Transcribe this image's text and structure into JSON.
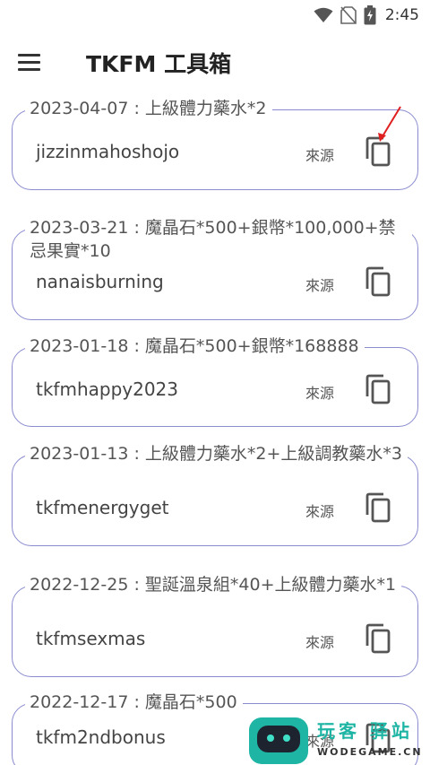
{
  "status_bar": {
    "time": "2:45",
    "icons": [
      "wifi-icon",
      "no-sim-icon",
      "battery-charging-icon"
    ]
  },
  "app_bar": {
    "menu_icon": "hamburger-menu-icon",
    "title": "TKFM 工具箱"
  },
  "codes": [
    {
      "title": "2023-04-07 : 上級體力藥水*2",
      "code": "jizzinmahoshojo",
      "source_label": "來源",
      "copy_icon": "copy-icon"
    },
    {
      "title": "2023-03-21 : 魔晶石*500+銀幣*100,000+禁忌果實*10",
      "code": "nanaisburning",
      "source_label": "來源",
      "copy_icon": "copy-icon"
    },
    {
      "title": "2023-01-18 : 魔晶石*500+銀幣*168888",
      "code": "tkfmhappy2023",
      "source_label": "來源",
      "copy_icon": "copy-icon"
    },
    {
      "title": "2023-01-13 : 上級體力藥水*2+上級調教藥水*3",
      "code": "tkfmenergyget",
      "source_label": "來源",
      "copy_icon": "copy-icon"
    },
    {
      "title": "2022-12-25 : 聖誕溫泉組*40+上級體力藥水*1",
      "code": "tkfmsexmas",
      "source_label": "來源",
      "copy_icon": "copy-icon"
    },
    {
      "title": "2022-12-17 : 魔晶石*500",
      "code": "tkfm2ndbonus",
      "source_label": "來源",
      "copy_icon": "copy-icon"
    }
  ],
  "watermark": {
    "title": "玩客 驿站",
    "url": "WODEGAME.CN"
  },
  "colors": {
    "card_border": "#8a8ccf",
    "annotation_arrow": "#e02020",
    "watermark_accent": "#1fb5a4"
  }
}
